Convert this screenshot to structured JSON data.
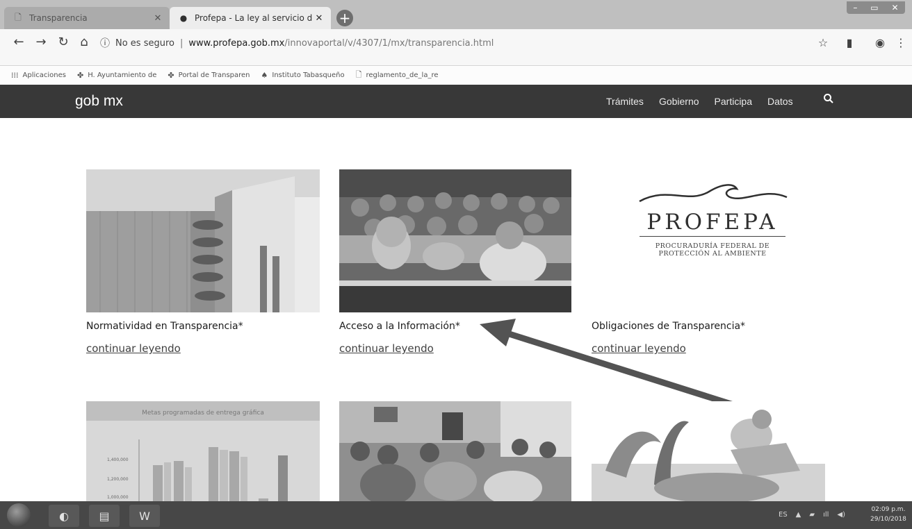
{
  "browser": {
    "tabs": [
      {
        "title": "Transparencia"
      },
      {
        "title": "Profepa - La ley al servicio de la ·"
      }
    ],
    "address": {
      "security": "No es seguro",
      "host": "www.profepa.gob.mx",
      "path": "/innovaportal/v/4307/1/mx/transparencia.html"
    },
    "bookmarks": [
      {
        "label": "Aplicaciones"
      },
      {
        "label": "H. Ayuntamiento de"
      },
      {
        "label": "Portal de Transparen"
      },
      {
        "label": "Instituto Tabasqueño"
      },
      {
        "label": "reglamento_de_la_re"
      }
    ]
  },
  "site": {
    "logo": "gob mx",
    "nav": [
      "Trámites",
      "Gobierno",
      "Participa",
      "Datos"
    ]
  },
  "cards": [
    {
      "title": "Normatividad en Transparencia*",
      "link": "continuar leyendo"
    },
    {
      "title": "Acceso a la Información*",
      "link": "continuar leyendo"
    },
    {
      "title": "Obligaciones de Transparencia*",
      "link": "continuar leyendo"
    }
  ],
  "profepa_logo": {
    "name": "PROFEPA",
    "line1": "PROCURADURÍA FEDERAL DE",
    "line2": "PROTECCIÓN AL AMBIENTE"
  },
  "chart_thumb_title": "Metas programadas de entrega gráfica",
  "chart_thumb_ticks": [
    "1,400,000",
    "1,200,000",
    "1,000,000"
  ],
  "taskbar": {
    "lang": "ES",
    "time": "02:09 p.m.",
    "date": "29/10/2018"
  },
  "icons": [
    "back-icon",
    "forward-icon",
    "reload-icon",
    "home-icon",
    "info-icon",
    "star-icon",
    "extension-icon",
    "profile-icon",
    "menu-icon",
    "search-icon"
  ]
}
